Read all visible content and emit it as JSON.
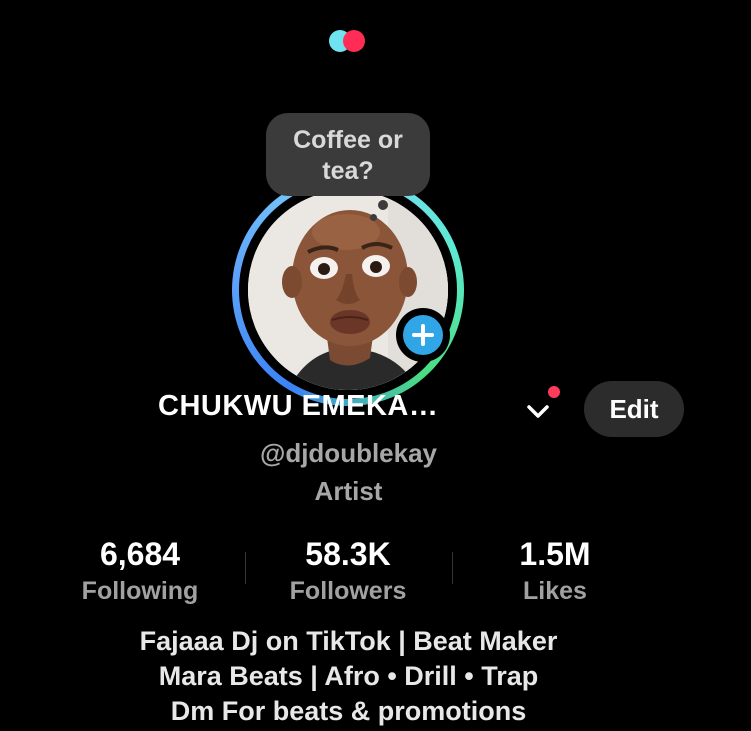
{
  "status_bubble": {
    "text_line1": "Coffee or",
    "text_line2": "tea?"
  },
  "profile": {
    "display_name": "CHUKWU EMEKA…",
    "username": "@djdoublekay",
    "category": "Artist",
    "edit_label": "Edit"
  },
  "stats": {
    "following": {
      "value": "6,684",
      "label": "Following"
    },
    "followers": {
      "value": "58.3K",
      "label": "Followers"
    },
    "likes": {
      "value": "1.5M",
      "label": "Likes"
    }
  },
  "bio": {
    "line1": "Fajaaa Dj on TikTok | Beat Maker",
    "line2": "Mara Beats | Afro • Drill • Trap",
    "line3": "Dm For beats & promotions"
  },
  "icons": {
    "logo": "app-logo-dots",
    "chevron": "chevron-down-icon",
    "add": "plus-icon"
  },
  "colors": {
    "background": "#000000",
    "accent_blue": "#31a6e6",
    "notification_red": "#ff3b5c",
    "logo_cyan": "#6fe3f0",
    "logo_red": "#ff2d55"
  }
}
